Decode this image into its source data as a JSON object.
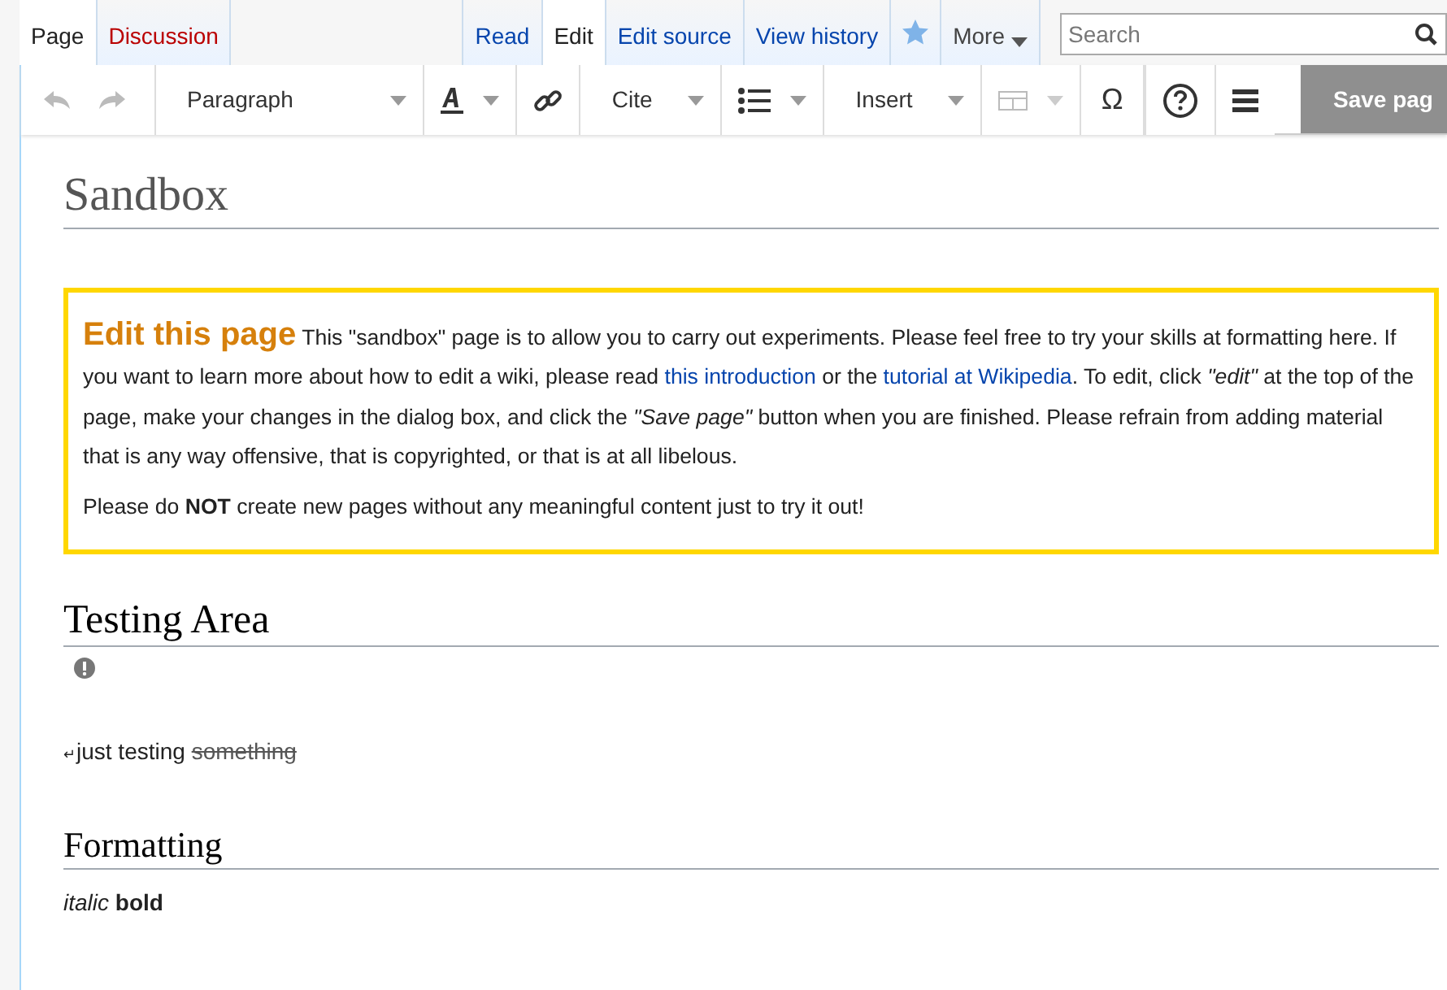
{
  "tabs_left": [
    {
      "label": "Page",
      "selected": true,
      "new": false
    },
    {
      "label": "Discussion",
      "selected": false,
      "new": true
    }
  ],
  "tabs_right": [
    {
      "kind": "tab",
      "label": "Read",
      "selected": false
    },
    {
      "kind": "tab",
      "label": "Edit",
      "selected": true
    },
    {
      "kind": "tab",
      "label": "Edit source",
      "selected": false
    },
    {
      "kind": "tab",
      "label": "View history",
      "selected": false
    },
    {
      "kind": "star",
      "selected": false
    },
    {
      "kind": "menu",
      "label": "More",
      "selected": false
    }
  ],
  "search": {
    "placeholder": "Search"
  },
  "toolbar": [
    {
      "kind": "undo",
      "disabled": true
    },
    {
      "kind": "redo",
      "disabled": true
    },
    {
      "kind": "dropdown",
      "label": "Paragraph",
      "disabled": false
    },
    {
      "kind": "textstyle",
      "disabled": false
    },
    {
      "kind": "link",
      "disabled": false
    },
    {
      "kind": "dropdown",
      "label": "Cite",
      "disabled": false
    },
    {
      "kind": "list",
      "disabled": false
    },
    {
      "kind": "dropdown",
      "label": "Insert",
      "disabled": false
    },
    {
      "kind": "table",
      "disabled": true
    },
    {
      "kind": "char",
      "label": "Ω",
      "disabled": false
    },
    {
      "kind": "help",
      "disabled": false
    },
    {
      "kind": "menu",
      "disabled": false
    },
    {
      "kind": "save",
      "label": "Save pag",
      "disabled": true
    }
  ],
  "title": "Sandbox",
  "notice": {
    "title": "Edit this page",
    "paragraph": [
      {
        "kind": "text",
        "text": " This \"sandbox\" page is to allow you to carry out experiments. Please feel free to try your skills at formatting here. If you want to learn more about how to edit a wiki, please read "
      },
      {
        "kind": "link",
        "text": "this introduction"
      },
      {
        "kind": "text",
        "text": " or the "
      },
      {
        "kind": "link",
        "text": "tutorial at Wikipedia"
      },
      {
        "kind": "text",
        "text": ". To edit, click *\"edit\"* at the top of the page, make your changes in the dialog box, and click the *\"Save page\"* button when you are finished. Please refrain from adding material that is any way offensive, that is copyrighted, or that is at all libelous."
      }
    ],
    "note": "Please do **NOT** create new pages without any meaningful content just to try it out!"
  },
  "sections": [
    {
      "heading": "Testing Area",
      "warning": true,
      "lines": [
        [
          {
            "kind": "return-mark",
            "text": "↵"
          },
          {
            "kind": "text",
            "text": "just testing "
          },
          {
            "kind": "struck",
            "text": "something"
          }
        ]
      ]
    },
    {
      "heading": "Formatting",
      "lines": [
        [
          {
            "kind": "text",
            "text": "*italic* **bold**"
          }
        ]
      ]
    }
  ]
}
